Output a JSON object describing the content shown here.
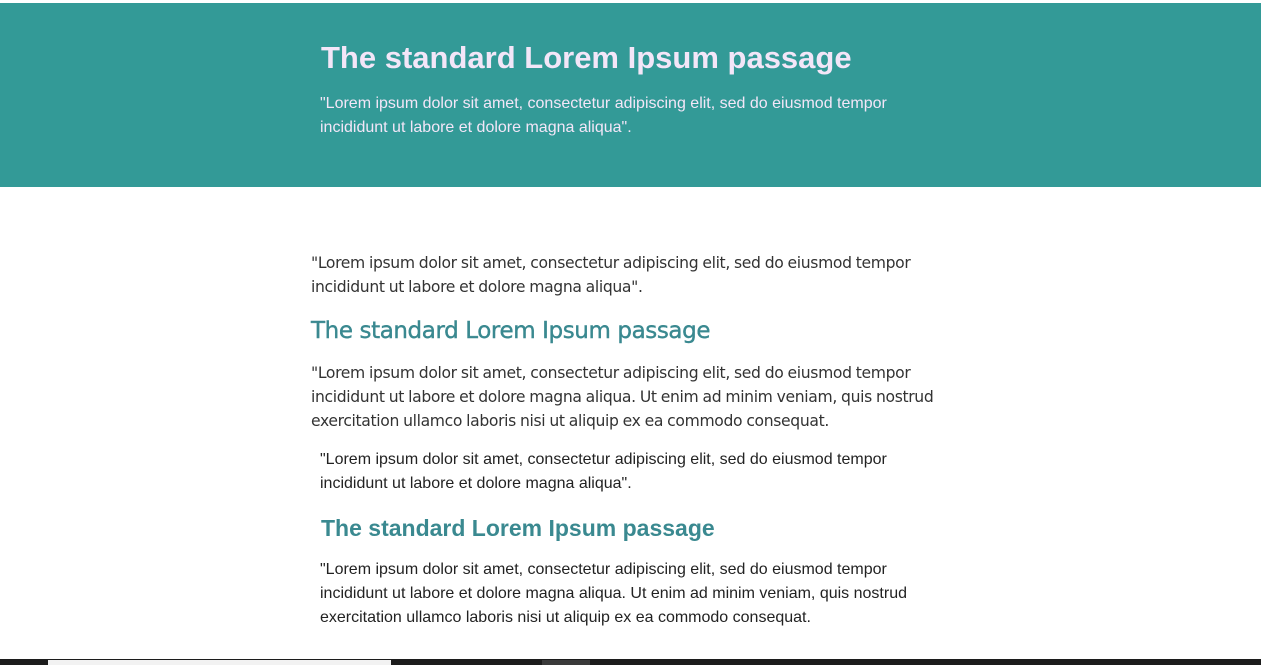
{
  "hero": {
    "title": "The standard Lorem Ipsum passage",
    "text": "\"Lorem ipsum dolor sit amet, consectetur adipiscing elit, sed do eiusmod tempor incididunt ut labore et dolore magna aliqua\"."
  },
  "section_a": {
    "paragraph_1": "\"Lorem ipsum dolor sit amet, consectetur adipiscing elit, sed do eiusmod tempor incididunt ut labore et dolore magna aliqua\".",
    "heading": "The standard Lorem Ipsum passage",
    "paragraph_2": "\"Lorem ipsum dolor sit amet, consectetur adipiscing elit, sed do eiusmod tempor incididunt ut labore et dolore magna aliqua. Ut enim ad minim veniam, quis nostrud exercitation ullamco laboris nisi ut aliquip ex ea commodo consequat."
  },
  "section_b": {
    "paragraph_1": "\"Lorem ipsum dolor sit amet, consectetur adipiscing elit, sed do eiusmod tempor incididunt ut labore et dolore magna aliqua\".",
    "heading": "The standard Lorem Ipsum passage",
    "paragraph_2": "\"Lorem ipsum dolor sit amet, consectetur adipiscing elit, sed do eiusmod tempor incididunt ut labore et dolore magna aliqua. Ut enim ad minim veniam, quis nostrud exercitation ullamco laboris nisi ut aliquip ex ea commodo consequat."
  },
  "colors": {
    "hero_background": "#339a97",
    "hero_text": "#f3e6f8",
    "heading_accent": "#3a8990",
    "body_text": "#333333"
  }
}
